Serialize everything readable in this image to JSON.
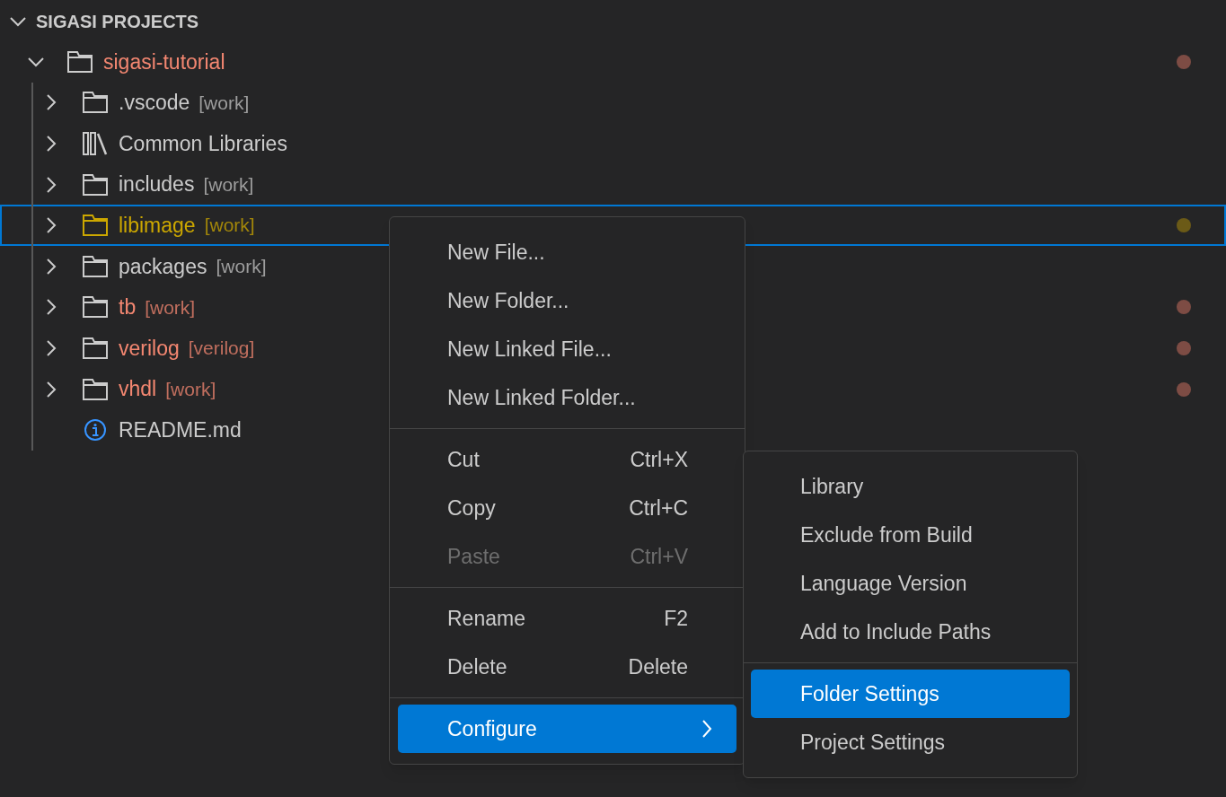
{
  "panel": {
    "title": "SIGASI PROJECTS",
    "expanded": true
  },
  "tree": [
    {
      "label": "sigasi-tutorial",
      "kind": "folder",
      "expanded": true,
      "selected": false,
      "color": "#f48771",
      "status_dot": {
        "color": "#7d4c44"
      },
      "children": [
        {
          "label": ".vscode",
          "tag": "[work]",
          "kind": "folder",
          "expanded": false,
          "selected": false
        },
        {
          "label": "Common Libraries",
          "kind": "library",
          "expanded": false,
          "selected": false
        },
        {
          "label": "includes",
          "tag": "[work]",
          "kind": "folder",
          "expanded": false,
          "selected": false
        },
        {
          "label": "libimage",
          "tag": "[work]",
          "kind": "folder",
          "expanded": false,
          "selected": true,
          "color": "#cca700",
          "status_dot": {
            "color": "#6b5a17"
          }
        },
        {
          "label": "packages",
          "tag": "[work]",
          "kind": "folder",
          "expanded": false,
          "selected": false
        },
        {
          "label": "tb",
          "tag": "[work]",
          "kind": "folder",
          "expanded": false,
          "selected": false,
          "color": "#f48771",
          "status_dot": {
            "color": "#7d4c44"
          }
        },
        {
          "label": "verilog",
          "tag": "[verilog]",
          "kind": "folder",
          "expanded": false,
          "selected": false,
          "color": "#f48771",
          "status_dot": {
            "color": "#7d4c44"
          }
        },
        {
          "label": "vhdl",
          "tag": "[work]",
          "kind": "folder",
          "expanded": false,
          "selected": false,
          "color": "#f48771",
          "status_dot": {
            "color": "#7d4c44"
          }
        },
        {
          "label": "README.md",
          "kind": "info"
        }
      ]
    }
  ],
  "context_menu": {
    "groups": [
      [
        {
          "label": "New File...",
          "disabled": false,
          "selected": false
        },
        {
          "label": "New Folder...",
          "disabled": false,
          "selected": false
        },
        {
          "label": "New Linked File...",
          "disabled": false,
          "selected": false
        },
        {
          "label": "New Linked Folder...",
          "disabled": false,
          "selected": false
        }
      ],
      [
        {
          "label": "Cut",
          "shortcut": "Ctrl+X",
          "disabled": false,
          "selected": false
        },
        {
          "label": "Copy",
          "shortcut": "Ctrl+C",
          "disabled": false,
          "selected": false
        },
        {
          "label": "Paste",
          "shortcut": "Ctrl+V",
          "disabled": true,
          "selected": false
        }
      ],
      [
        {
          "label": "Rename",
          "shortcut": "F2",
          "disabled": false,
          "selected": false
        },
        {
          "label": "Delete",
          "shortcut": "Delete",
          "disabled": false,
          "selected": false
        }
      ],
      [
        {
          "label": "Configure",
          "submenu": true,
          "disabled": false,
          "selected": true
        }
      ]
    ]
  },
  "submenu": {
    "groups": [
      [
        {
          "label": "Library",
          "disabled": false,
          "selected": false
        },
        {
          "label": "Exclude from Build",
          "disabled": false,
          "selected": false
        },
        {
          "label": "Language Version",
          "disabled": false,
          "selected": false
        },
        {
          "label": "Add to Include Paths",
          "disabled": false,
          "selected": false
        }
      ],
      [
        {
          "label": "Folder Settings",
          "disabled": false,
          "selected": true
        },
        {
          "label": "Project Settings",
          "disabled": false,
          "selected": false
        }
      ]
    ]
  }
}
